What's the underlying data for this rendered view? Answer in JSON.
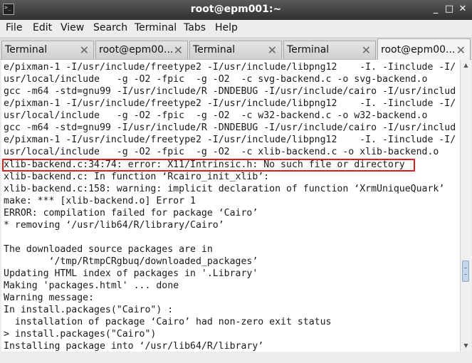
{
  "window": {
    "title": "root@epm001:~",
    "controls": {
      "minimize": "_",
      "maximize": "□",
      "close": "✕"
    }
  },
  "menu": [
    "File",
    "Edit",
    "View",
    "Search",
    "Terminal",
    "Tabs",
    "Help"
  ],
  "tabs": [
    {
      "label": "Terminal",
      "close": "✕"
    },
    {
      "label": "root@epm00...",
      "close": "✕"
    },
    {
      "label": "Terminal",
      "close": "✕"
    },
    {
      "label": "Terminal",
      "close": "✕"
    },
    {
      "label": "root@epm00...",
      "close": "✕",
      "active": true
    }
  ],
  "terminal": {
    "lines": [
      "e/pixman-1 -I/usr/include/freetype2 -I/usr/include/libpng12    -I. -Iinclude -I/",
      "usr/local/include   -g -O2 -fpic  -g -O2  -c svg-backend.c -o svg-backend.o",
      "gcc -m64 -std=gnu99 -I/usr/include/R -DNDEBUG -I/usr/include/cairo -I/usr/includ",
      "e/pixman-1 -I/usr/include/freetype2 -I/usr/include/libpng12    -I. -Iinclude -I/",
      "usr/local/include   -g -O2 -fpic  -g -O2  -c w32-backend.c -o w32-backend.o",
      "gcc -m64 -std=gnu99 -I/usr/include/R -DNDEBUG -I/usr/include/cairo -I/usr/includ",
      "e/pixman-1 -I/usr/include/freetype2 -I/usr/include/libpng12    -I. -Iinclude -I/",
      "usr/local/include   -g -O2 -fpic  -g -O2  -c xlib-backend.c -o xlib-backend.o",
      "xlib-backend.c:34:74: error: X11/Intrinsic.h: No such file or directory",
      "xlib-backend.c: In function ‘Rcairo_init_xlib’:",
      "xlib-backend.c:158: warning: implicit declaration of function ‘XrmUniqueQuark’",
      "make: *** [xlib-backend.o] Error 1",
      "ERROR: compilation failed for package ‘Cairo’",
      "* removing ‘/usr/lib64/R/library/Cairo’",
      "",
      "The downloaded source packages are in",
      "        ‘/tmp/RtmpCRgbuq/downloaded_packages’",
      "Updating HTML index of packages in '.Library'",
      "Making 'packages.html' ... done",
      "Warning message:",
      "In install.packages(\"Cairo\") :",
      "  installation of package ‘Cairo’ had non-zero exit status",
      "> install.packages(\"Cairo\")",
      "Installing package into ‘/usr/lib64/R/library’"
    ],
    "highlight_color": "#d8221d"
  },
  "scrollbar": {
    "up": "▲",
    "down": "▼"
  }
}
